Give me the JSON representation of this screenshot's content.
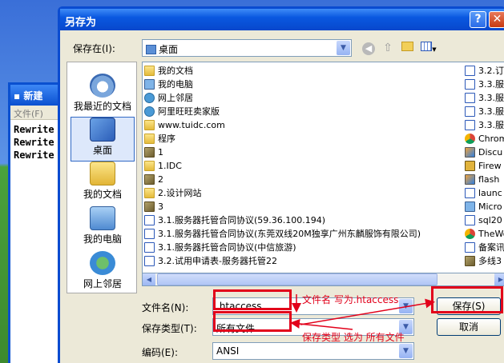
{
  "background_window": {
    "title": "新建",
    "menu": "文件(F)",
    "lines": [
      "Rewrite",
      "Rewrite",
      "Rewrite"
    ]
  },
  "dialog": {
    "title": "另存为",
    "help_glyph": "?",
    "close_glyph": "✕",
    "save_in_label": "保存在(I):",
    "save_in_value": "桌面",
    "places": [
      {
        "label": "我最近的文档",
        "icon": "recent-docs-icon"
      },
      {
        "label": "桌面",
        "icon": "desktop-icon"
      },
      {
        "label": "我的文档",
        "icon": "my-documents-icon"
      },
      {
        "label": "我的电脑",
        "icon": "my-computer-icon"
      },
      {
        "label": "网上邻居",
        "icon": "network-places-icon"
      }
    ],
    "files_col1": [
      {
        "name": "我的文档",
        "type": "folder"
      },
      {
        "name": "我的电脑",
        "type": "pc"
      },
      {
        "name": "网上邻居",
        "type": "net"
      },
      {
        "name": "阿里旺旺卖家版",
        "type": "net"
      },
      {
        "name": "www.tuidc.com",
        "type": "folder"
      },
      {
        "name": "程序",
        "type": "folder"
      },
      {
        "name": "1",
        "type": "img"
      },
      {
        "name": "1.IDC",
        "type": "folder"
      },
      {
        "name": "2",
        "type": "img"
      },
      {
        "name": "2.设计网站",
        "type": "folder"
      },
      {
        "name": "3",
        "type": "img"
      },
      {
        "name": "3.1.服务器托管合同协议(59.36.100.194)",
        "type": "doc"
      },
      {
        "name": "3.1.服务器托管合同协议(东莞双线20M独享广州东麟服饰有限公司)",
        "type": "doc"
      },
      {
        "name": "3.1.服务器托管合同协议(中信旅游)",
        "type": "doc"
      },
      {
        "name": "3.2.试用申请表-服务器托管22",
        "type": "doc"
      }
    ],
    "files_col2": [
      {
        "name": "3.2.订",
        "type": "doc"
      },
      {
        "name": "3.3.服",
        "type": "doc"
      },
      {
        "name": "3.3.服",
        "type": "doc"
      },
      {
        "name": "3.3.服",
        "type": "doc"
      },
      {
        "name": "3.3.服",
        "type": "doc"
      },
      {
        "name": "Chrome",
        "type": "chrome"
      },
      {
        "name": "Discu",
        "type": "app"
      },
      {
        "name": "Firew",
        "type": "fw"
      },
      {
        "name": "flash",
        "type": "app"
      },
      {
        "name": "launc",
        "type": "doc"
      },
      {
        "name": "Micro",
        "type": "pc"
      },
      {
        "name": "sql20",
        "type": "doc"
      },
      {
        "name": "TheWo",
        "type": "chrome"
      },
      {
        "name": "备案讯",
        "type": "doc"
      },
      {
        "name": "多线3",
        "type": "img"
      }
    ],
    "filename_label": "文件名(N):",
    "filename_value": ".htaccess",
    "filetype_label": "保存类型(T):",
    "filetype_value": "所有文件",
    "encoding_label": "编码(E):",
    "encoding_value": "ANSI",
    "save_button": "保存(S)",
    "cancel_button": "取消"
  },
  "annotations": {
    "filename_note": "文件名 写为.htaccess",
    "filetype_note": "保存类型 选为 所有文件"
  },
  "colors": {
    "annotation": "#e2001a",
    "titlebar": "#0a58e0"
  }
}
